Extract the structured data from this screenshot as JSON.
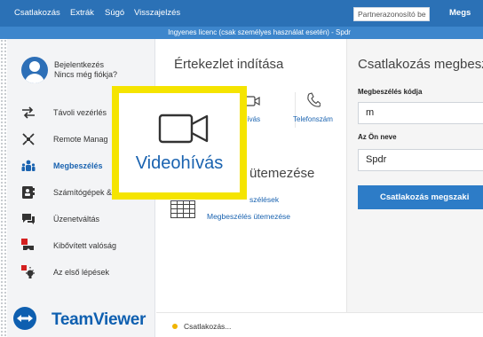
{
  "menubar": {
    "items": [
      "Csatlakozás",
      "Extrák",
      "Súgó",
      "Visszajelzés"
    ],
    "partner_id_placeholder": "Partnerazonosító be",
    "connect_label": "Megs"
  },
  "license_banner": "Ingyenes licenc (csak személyes használat esetén) - Spdr",
  "sidebar": {
    "profile": {
      "login": "Bejelentkezés",
      "no_account": "Nincs még fiókja?"
    },
    "items": [
      {
        "label": "Távoli vezérlés",
        "icon": "arrows-icon"
      },
      {
        "label": "Remote Manag",
        "icon": "remote-management-icon"
      },
      {
        "label": "Megbeszélés",
        "icon": "meeting-icon",
        "active": true
      },
      {
        "label": "Számítógépek &",
        "icon": "computers-contacts-icon"
      },
      {
        "label": "Üzenetváltás",
        "icon": "chat-icon"
      },
      {
        "label": "Kibővített valóság",
        "icon": "augmented-reality-icon"
      },
      {
        "label": "Az első lépések",
        "icon": "first-steps-icon"
      }
    ],
    "brand": "TeamViewer"
  },
  "meeting": {
    "title": "Értekezlet indítása",
    "videocall_label": "hívás",
    "phone_label": "Telefonszám",
    "schedule_heading": "ütemezése",
    "meetings_link": "szélések",
    "schedule_link": "Megbeszélés ütemezése"
  },
  "join": {
    "title": "Csatlakozás megbesz",
    "code_label": "Megbeszélés kódja",
    "code_value": "m",
    "name_label": "Az Ön neve",
    "name_value": "Spdr",
    "button_label": "Csatlakozás megszaki"
  },
  "status": {
    "text": "Csatlakozás..."
  },
  "callout": {
    "label": "Videohívás"
  },
  "colors": {
    "menubar_bg": "#2b71b6",
    "accent": "#1a63b0",
    "button_bg": "#2d7cc7",
    "highlight": "#f5e400",
    "status_dot": "#f0b400"
  }
}
